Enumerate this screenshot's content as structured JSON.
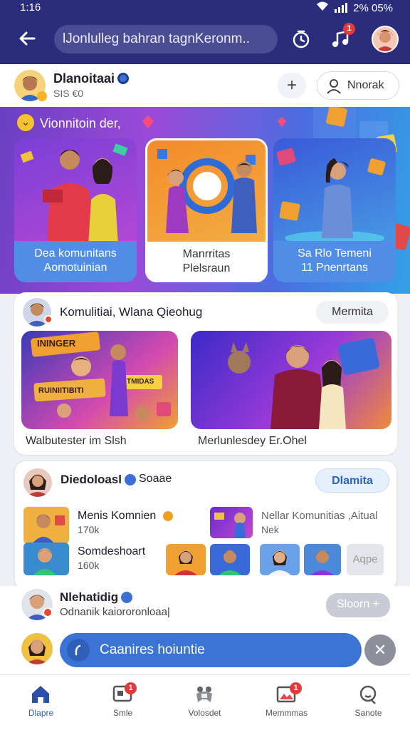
{
  "status_bar": {
    "time": "1:16",
    "battery": "2% 05%"
  },
  "top_bar": {
    "search_text": "lJonlulleg bahran tagnKeronm..",
    "icons": [
      "back-arrow-icon",
      "timer-icon",
      "music-note-icon",
      "profile-avatar"
    ],
    "music_badge": "1"
  },
  "profile": {
    "name": "Dlanoitaai",
    "sub": "SIS €0",
    "plus_label": "+",
    "action_label": "Nnorak"
  },
  "hero": {
    "title": "Vionnitoin der,",
    "cards": [
      {
        "caption_line1": "Dea komunitans",
        "caption_line2": "Aomotuinian"
      },
      {
        "caption_line1": "Manrritas",
        "caption_line2": "Plelsraun"
      },
      {
        "caption_line1": "Sa Rlo Temeni",
        "caption_line2": "11 Pnenrtans"
      }
    ]
  },
  "section1": {
    "title": "Komulitiai, Wlana Qieohug",
    "button": "Mermita",
    "thumb1_banner_top": "ININGER",
    "thumb1_banner_mid": "RUINIITIBITI",
    "thumb1_banner_small": "TMIDAS",
    "caption1": "Walbutester im Slsh",
    "caption2": "Merlunlesdey Er.Ohel"
  },
  "section2": {
    "title": "Diedoloasl",
    "title_suffix": "Soaae",
    "button": "Dlamita",
    "rows": [
      {
        "title": "Menis Komnien",
        "count": "170k"
      },
      {
        "title": "Somdeshoart",
        "count": "160k"
      }
    ],
    "right_title": "Nellar Komunitias ,Aitual",
    "right_sub": "Nek",
    "more_label": "Aqpe"
  },
  "section3": {
    "title": "Nlehatidig",
    "sub": "Odnanik kaiororonloaa|",
    "button": "Sloorn +"
  },
  "float_bar": {
    "text": "Caanires hoiuntie",
    "close": "✕"
  },
  "bottom_nav": [
    {
      "label": "Dlapre",
      "icon": "home-icon",
      "active": true
    },
    {
      "label": "Smle",
      "icon": "chat-icon",
      "badge": "1"
    },
    {
      "label": "Volosdet",
      "icon": "gamepad-icon"
    },
    {
      "label": "Memmmas",
      "icon": "gallery-icon",
      "badge": "1"
    },
    {
      "label": "Sanote",
      "icon": "search-icon"
    }
  ]
}
